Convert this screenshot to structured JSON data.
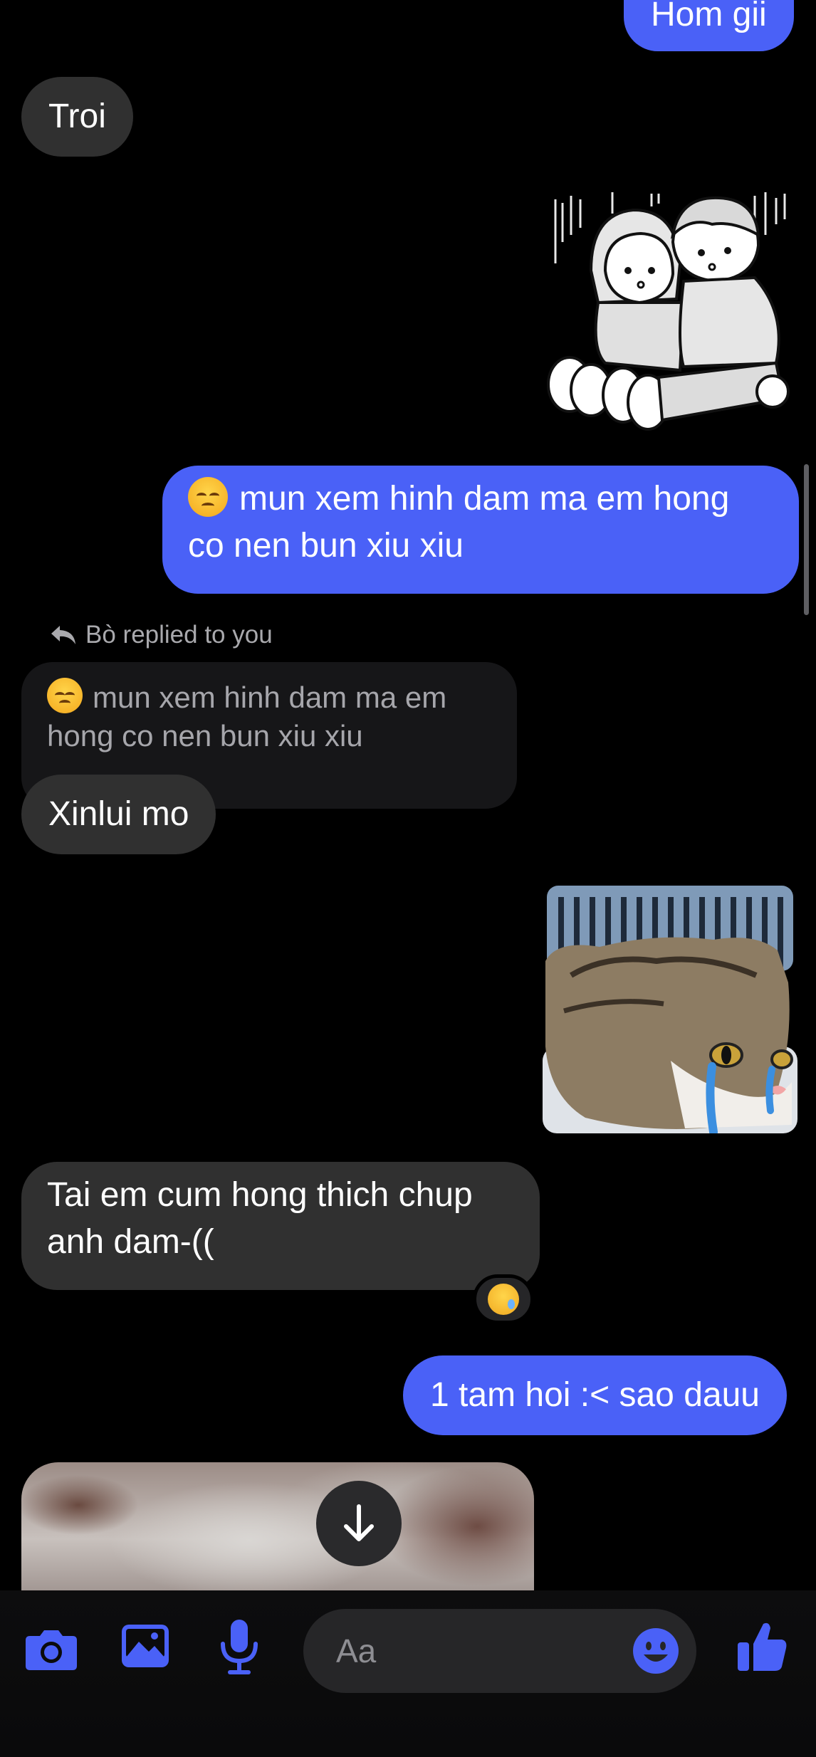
{
  "colors": {
    "outgoing": "#4a61f7",
    "incoming": "#303030",
    "accent": "#4a61f7",
    "background": "#000000"
  },
  "messages": {
    "top_outgoing": "Hom gii",
    "troi": "Troi",
    "sad_line1": "mun xem hinh dam ma em hong",
    "sad_line2": "co nen bun xiu xiu",
    "reply_label": "Bò replied to you",
    "quoted_line1": "mun xem hinh dam ma em",
    "quoted_line2": "hong co nen bun xiu xiu",
    "xinlui": "Xinlui mo",
    "tai_line1": "Tai em cum hong thich chup",
    "tai_line2": "anh dam-((",
    "tam_hoi": "1 tam hoi :< sao dauu"
  },
  "reaction": {
    "emoji": "crying-face"
  },
  "composer": {
    "placeholder": "Aa"
  },
  "toolbar": {
    "icons": [
      "camera-icon",
      "gallery-icon",
      "microphone-icon",
      "emoji-icon",
      "thumbs-up-icon"
    ]
  }
}
